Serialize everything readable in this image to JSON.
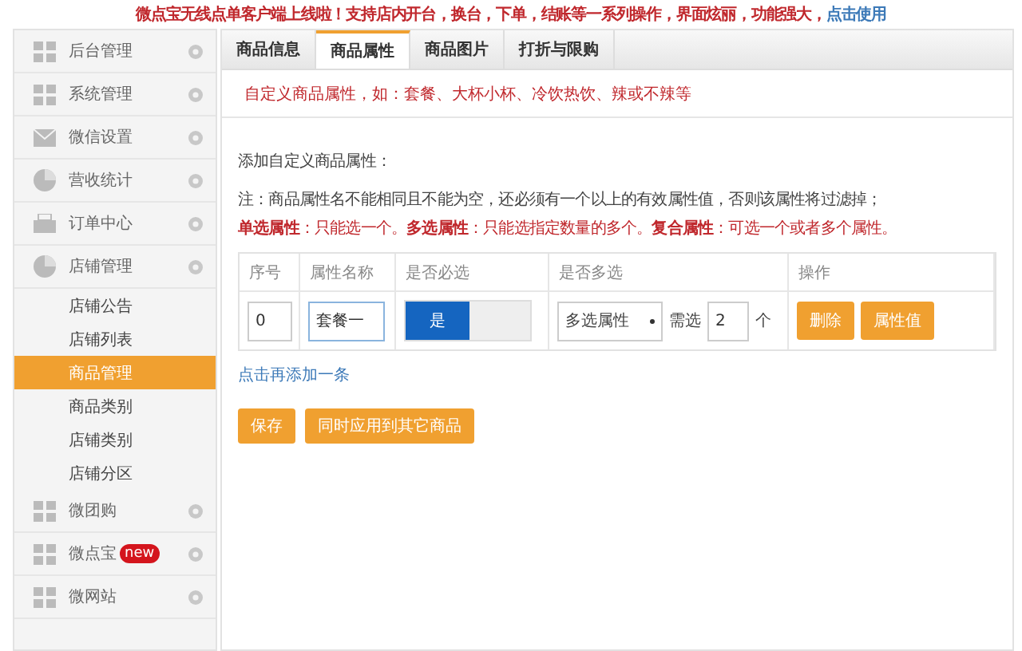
{
  "banner": {
    "text": "微点宝无线点单客户端上线啦！支持店内开台，换台，下单，结账等一系列操作，界面炫丽，功能强大，",
    "link": "点击使用"
  },
  "sidebar": {
    "items": [
      {
        "label": "后台管理",
        "selected": false
      },
      {
        "label": "系统管理",
        "selected": false
      },
      {
        "label": "微信设置",
        "selected": false
      },
      {
        "label": "营收统计",
        "selected": false
      },
      {
        "label": "订单中心",
        "selected": false
      },
      {
        "label": "店铺管理",
        "selected": false,
        "children": [
          {
            "label": "店铺公告",
            "selected": false
          },
          {
            "label": "店铺列表",
            "selected": false
          },
          {
            "label": "商品管理",
            "selected": true
          },
          {
            "label": "商品类别",
            "selected": false
          },
          {
            "label": "店铺类别",
            "selected": false
          },
          {
            "label": "店铺分区",
            "selected": false
          }
        ]
      },
      {
        "label": "微团购",
        "selected": false
      },
      {
        "label": "微点宝",
        "selected": false,
        "badge": "new"
      },
      {
        "label": "微网站",
        "selected": false
      }
    ]
  },
  "tabs": [
    {
      "label": "商品信息",
      "selected": false
    },
    {
      "label": "商品属性",
      "selected": true
    },
    {
      "label": "商品图片",
      "selected": false
    },
    {
      "label": "打折与限购",
      "selected": false
    }
  ],
  "hint": "自定义商品属性，如：套餐、大杯小杯、冷饮热饮、辣或不辣等",
  "section_title": "添加自定义商品属性：",
  "note": "注：商品属性名不能相同且不能为空，还必须有一个以上的有效属性值，否则该属性将过滤掉；",
  "rules": "**单选属性**：只能选一个。**多选属性**：只能选指定数量的多个。**复合属性**：可选一个或者多个属性。",
  "table": {
    "columns": [
      "序号",
      "属性名称",
      "是否必选",
      "是否多选",
      "操作"
    ],
    "rows": [
      {
        "index": "0",
        "name": "套餐一",
        "required": {
          "label": "是",
          "on": true
        },
        "select": "多选属性",
        "need_label": "需选",
        "need_value": "2",
        "unit": "个",
        "actions": [
          "删除",
          "属性值"
        ]
      }
    ]
  },
  "add_link": "点击再添加一条",
  "buttons": [
    "保存",
    "同时应用到其它商品"
  ]
}
